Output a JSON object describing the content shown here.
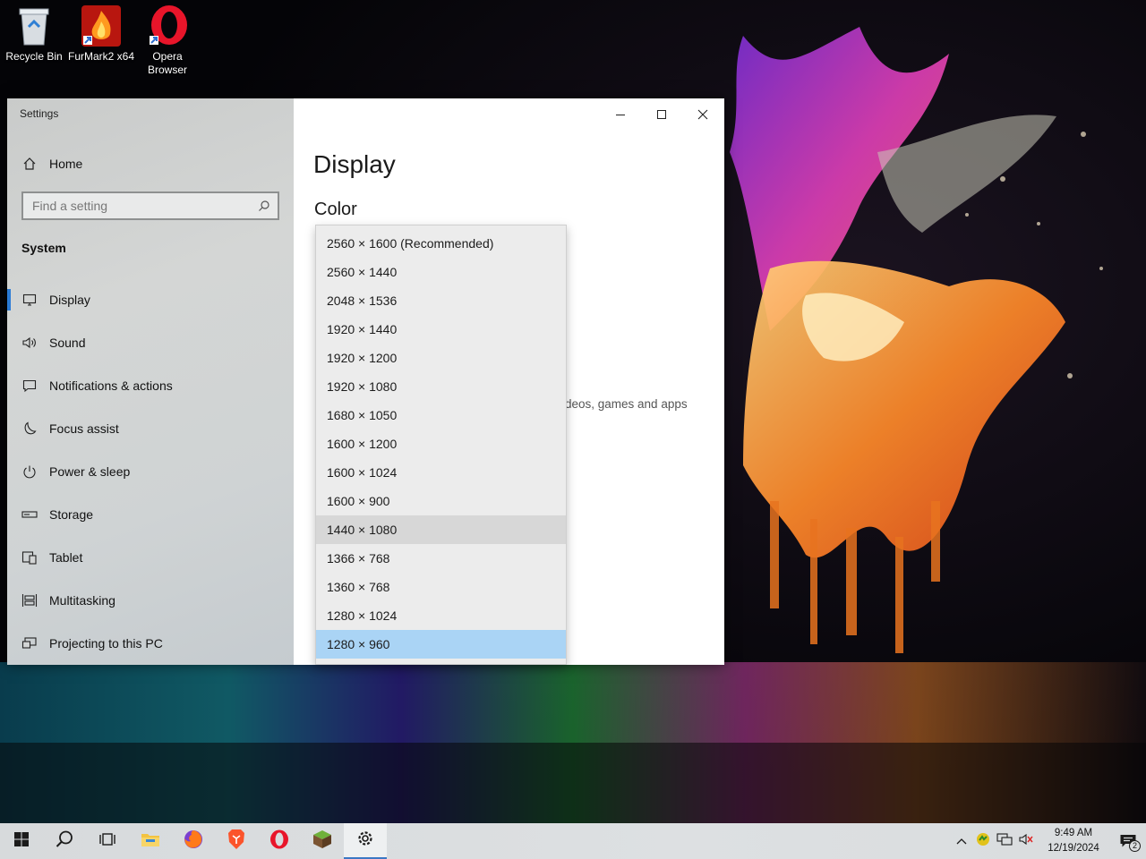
{
  "desktop": {
    "icons": [
      {
        "label": "Recycle Bin"
      },
      {
        "label": "FurMark2 x64"
      },
      {
        "label": "Opera Browser"
      }
    ]
  },
  "window": {
    "app_title": "Settings",
    "controls": {
      "minimize": "minimize-icon",
      "maximize": "maximize-icon",
      "close": "close-icon"
    }
  },
  "nav": {
    "home_label": "Home",
    "search": {
      "placeholder": "Find a setting"
    },
    "section": "System",
    "items": [
      {
        "label": "Display",
        "icon": "monitor-icon",
        "active": true
      },
      {
        "label": "Sound",
        "icon": "speaker-icon"
      },
      {
        "label": "Notifications & actions",
        "icon": "notification-icon"
      },
      {
        "label": "Focus assist",
        "icon": "moon-icon"
      },
      {
        "label": "Power & sleep",
        "icon": "power-icon"
      },
      {
        "label": "Storage",
        "icon": "storage-icon"
      },
      {
        "label": "Tablet",
        "icon": "tablet-icon"
      },
      {
        "label": "Multitasking",
        "icon": "multitasking-icon"
      },
      {
        "label": "Projecting to this PC",
        "icon": "projector-icon"
      }
    ]
  },
  "main": {
    "page_title": "Display",
    "color_heading": "Color",
    "obscured_text": "deos, games and apps",
    "obscured_mark": "."
  },
  "resolution_dropdown": {
    "options": [
      "2560 × 1600 (Recommended)",
      "2560 × 1440",
      "2048 × 1536",
      "1920 × 1440",
      "1920 × 1200",
      "1920 × 1080",
      "1680 × 1050",
      "1600 × 1200",
      "1600 × 1024",
      "1600 × 900",
      "1440 × 1080",
      "1366 × 768",
      "1360 × 768",
      "1280 × 1024",
      "1280 × 960"
    ],
    "hovered": "1440 × 1080",
    "selected": "1280 × 960"
  },
  "taskbar": {
    "apps": [
      "start-icon",
      "search-icon",
      "task-view-icon",
      "file-explorer-icon",
      "firefox-icon",
      "brave-icon",
      "opera-icon",
      "minecraft-icon",
      "settings-gear-icon"
    ],
    "clock": {
      "time": "9:49 AM",
      "date": "12/19/2024"
    },
    "notification_count": "2"
  },
  "colors": {
    "accent": "#2b7bd6",
    "selected_option": "#aad4f5",
    "hover_option": "#d7d7d7"
  }
}
